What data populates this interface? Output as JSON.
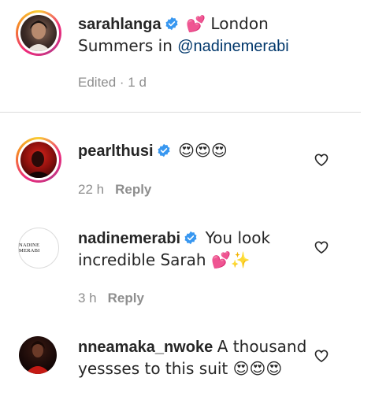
{
  "comments": [
    {
      "username": "sarahlanga",
      "text_pre": "💕 London Summers in ",
      "mention": "@nadinemerabi",
      "meta": "Edited · 1 d"
    },
    {
      "username": "pearlthusi",
      "text": "😍😍😍",
      "time": "22 h",
      "reply": "Reply"
    },
    {
      "username": "nadinemerabi",
      "avatar_logo": "NADINE MERABI",
      "text": "You look incredible Sarah 💕✨",
      "time": "3 h",
      "reply": "Reply"
    },
    {
      "username": "nneamaka_nwoke",
      "text": "A thousand yessses to this suit 😍😍😍"
    }
  ],
  "icons": {
    "verified": "verified-badge-icon",
    "like": "heart-outline-icon"
  },
  "colors": {
    "verified": "#3897f0",
    "mention": "#00376b",
    "meta": "#8e8e8e"
  }
}
